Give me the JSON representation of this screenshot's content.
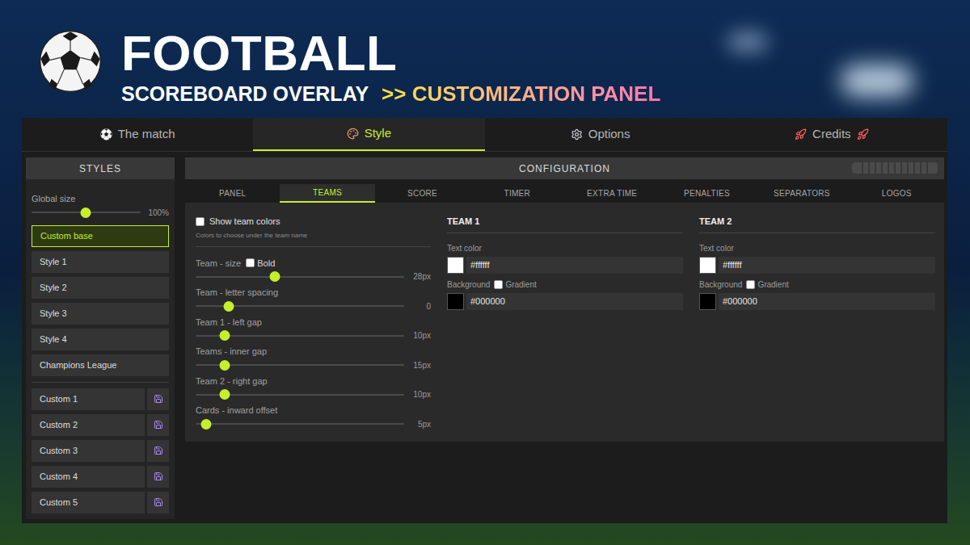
{
  "header": {
    "title": "FOOTBALL",
    "subtitle": "SCOREBOARD OVERLAY",
    "section": ">> CUSTOMIZATION PANEL"
  },
  "main_tabs": [
    {
      "label": "The match",
      "selected": false,
      "kind": "ball"
    },
    {
      "label": "Style",
      "selected": true,
      "kind": "palette"
    },
    {
      "label": "Options",
      "selected": false,
      "kind": "gear"
    },
    {
      "label": "Credits",
      "selected": false,
      "kind": "rocket"
    }
  ],
  "styles_panel": {
    "title": "STYLES",
    "global_size": {
      "label": "Global size",
      "level": 0.5,
      "reading": "100%"
    },
    "presets": [
      {
        "label": "Custom base",
        "selected": true
      },
      {
        "label": "Style 1",
        "selected": false
      },
      {
        "label": "Style 2",
        "selected": false
      },
      {
        "label": "Style 3",
        "selected": false
      },
      {
        "label": "Style 4",
        "selected": false
      },
      {
        "label": "Champions League",
        "selected": false
      }
    ],
    "custom_slots": [
      {
        "label": "Custom 1"
      },
      {
        "label": "Custom 2"
      },
      {
        "label": "Custom 3"
      },
      {
        "label": "Custom 4"
      },
      {
        "label": "Custom 5"
      }
    ]
  },
  "config": {
    "title": "CONFIGURATION",
    "tabs": [
      {
        "label": "PANEL",
        "selected": false
      },
      {
        "label": "TEAMS",
        "selected": true
      },
      {
        "label": "SCORE",
        "selected": false
      },
      {
        "label": "TIMER",
        "selected": false
      },
      {
        "label": "EXTRA TIME",
        "selected": false
      },
      {
        "label": "PENALTIES",
        "selected": false
      },
      {
        "label": "SEPARATORS",
        "selected": false
      },
      {
        "label": "LOGOS",
        "selected": false
      }
    ],
    "show_team_colors": {
      "label": "Show team colors",
      "checked": false,
      "hint": "Colors to choose under the team name"
    },
    "sliders": [
      {
        "label": "Team - size",
        "option": {
          "label": "Bold",
          "checked": false
        },
        "level": 0.38,
        "reading": "28px"
      },
      {
        "label": "Team - letter spacing",
        "level": 0.16,
        "reading": "0"
      },
      {
        "label": "Team 1 - left gap",
        "level": 0.14,
        "reading": "10px"
      },
      {
        "label": "Teams - inner gap",
        "level": 0.14,
        "reading": "15px"
      },
      {
        "label": "Team 2 - right gap",
        "level": 0.14,
        "reading": "10px"
      },
      {
        "label": "Cards - inward offset",
        "level": 0.05,
        "reading": "5px"
      }
    ],
    "teams": [
      {
        "title": "TEAM 1",
        "text_color": {
          "label": "Text color",
          "value": "#ffffff"
        },
        "background": {
          "label": "Background",
          "gradient": {
            "label": "Gradient",
            "checked": false
          },
          "value": "#000000"
        }
      },
      {
        "title": "TEAM 2",
        "text_color": {
          "label": "Text color",
          "value": "#ffffff"
        },
        "background": {
          "label": "Background",
          "gradient": {
            "label": "Gradient",
            "checked": false
          },
          "value": "#000000"
        }
      }
    ]
  }
}
